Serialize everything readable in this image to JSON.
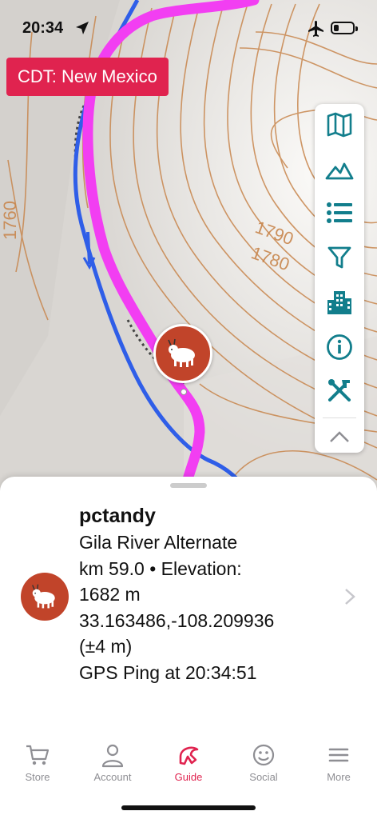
{
  "status_bar": {
    "time": "20:34"
  },
  "map": {
    "trail_badge": "CDT: New Mexico",
    "contour_labels": [
      "1790",
      "1780",
      "1760"
    ]
  },
  "tool_panel": {
    "buttons": [
      "map-icon",
      "terrain-icon",
      "list-icon",
      "filter-icon",
      "city-icon",
      "info-icon",
      "tools-icon",
      "chevron-up-icon"
    ]
  },
  "user_card": {
    "username": "pctandy",
    "route": "Gila River Alternate",
    "km_elevation": "km 59.0 • Elevation:",
    "elevation": "1682 m",
    "coordinates": "33.163486,-108.209936",
    "accuracy": "(±4 m)",
    "ping": "GPS Ping at 20:34:51"
  },
  "tabs": [
    {
      "label": "Store",
      "icon": "cart-icon"
    },
    {
      "label": "Account",
      "icon": "person-icon"
    },
    {
      "label": "Guide",
      "icon": "guide-logo-icon",
      "active": true
    },
    {
      "label": "Social",
      "icon": "smiley-icon"
    },
    {
      "label": "More",
      "icon": "hamburger-icon"
    }
  ],
  "colors": {
    "accent": "#e0234f",
    "tool_icon": "#127e8c",
    "trail": "#f23ef2",
    "water": "#2f5ee8",
    "contour": "#c8864d",
    "marker": "#c1442a"
  }
}
